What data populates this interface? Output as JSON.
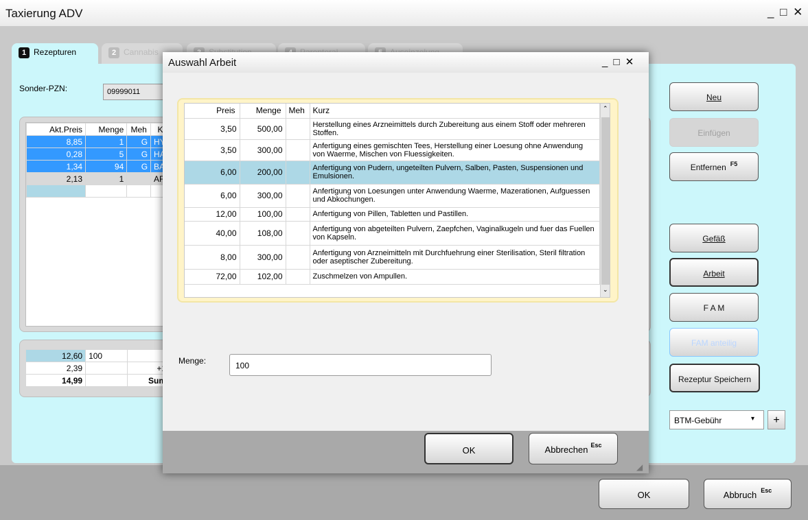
{
  "window": {
    "title": "Taxierung ADV",
    "controls": "_ □ ✕"
  },
  "tabs": [
    {
      "num": "1",
      "label": "Rezepturen"
    },
    {
      "num": "2",
      "label": "Cannabis"
    },
    {
      "num": "3",
      "label": "Substitution"
    },
    {
      "num": "4",
      "label": "Parenteral"
    },
    {
      "num": "5",
      "label": "Auseinzelung"
    }
  ],
  "pzn": {
    "label": "Sonder-PZN:",
    "value": "09999011"
  },
  "grid": {
    "headers": [
      "Akt.Preis",
      "Menge",
      "Meh",
      "K"
    ],
    "rows": [
      {
        "preis": "8,85",
        "menge": "1",
        "meh": "G",
        "k": "HY"
      },
      {
        "preis": "0,28",
        "menge": "5",
        "meh": "G",
        "k": "HA"
      },
      {
        "preis": "1,34",
        "menge": "94",
        "meh": "G",
        "k": "BA"
      },
      {
        "preis": "2,13",
        "menge": "1",
        "meh": "",
        "k": "AF"
      }
    ]
  },
  "summary": {
    "row1": {
      "preis": "12,60",
      "menge": "100"
    },
    "row2": {
      "preis": "2,39",
      "extra": "+1"
    },
    "row3": {
      "preis": "14,99",
      "extra": "Sum"
    }
  },
  "right_buttons": {
    "neu": "Neu",
    "einfuegen": "Einfügen",
    "entfernen": "Entfernen",
    "entfernen_key": "F5",
    "gefaess": "Gefäß",
    "arbeit": "Arbeit",
    "fam": "F A M",
    "fam_anteilig": "FAM anteilig",
    "rezeptur_speichern": "Rezeptur Speichern"
  },
  "btm": {
    "value": "BTM-Gebühr",
    "plus": "+"
  },
  "bottom": {
    "ok": "OK",
    "abbruch": "Abbruch",
    "abbruch_key": "Esc"
  },
  "dialog": {
    "title": "Auswahl Arbeit",
    "controls": "_ □ ✕",
    "columns": [
      "Preis",
      "Menge",
      "Meh",
      "Kurz"
    ],
    "rows": [
      {
        "preis": "3,50",
        "menge": "500,00",
        "meh": "",
        "kurz": "Herstellung eines Arzneimittels durch Zubereitung aus einem Stoff oder mehreren Stoffen."
      },
      {
        "preis": "3,50",
        "menge": "300,00",
        "meh": "",
        "kurz": "Anfertigung eines gemischten Tees, Herstellung einer Loesung ohne Anwendung von Waerme, Mischen von Fluessigkeiten."
      },
      {
        "preis": "6,00",
        "menge": "200,00",
        "meh": "",
        "kurz": "Anfertigung von Pudern, ungeteilten Pulvern, Salben, Pasten, Suspensionen und Emulsionen."
      },
      {
        "preis": "6,00",
        "menge": "300,00",
        "meh": "",
        "kurz": "Anfertigung von Loesungen unter Anwendung Waerme, Mazerationen, Aufguessen und Abkochungen."
      },
      {
        "preis": "12,00",
        "menge": "100,00",
        "meh": "",
        "kurz": "Anfertigung von Pillen, Tabletten und Pastillen."
      },
      {
        "preis": "40,00",
        "menge": "108,00",
        "meh": "",
        "kurz": "Anfertigung von abgeteilten Pulvern, Zaepfchen, Vaginalkugeln und fuer das Fuellen von Kapseln."
      },
      {
        "preis": "8,00",
        "menge": "300,00",
        "meh": "",
        "kurz": "Anfertigung von Arzneimitteln mit Durchfuehrung einer Sterilisation, Steril filtration oder aseptischer Zubereitung."
      },
      {
        "preis": "72,00",
        "menge": "102,00",
        "meh": "",
        "kurz": "Zuschmelzen von Ampullen."
      }
    ],
    "selected_index": 2,
    "menge_label": "Menge:",
    "menge_value": "100",
    "ok": "OK",
    "abbrechen": "Abbrechen",
    "abbrechen_key": "Esc"
  }
}
